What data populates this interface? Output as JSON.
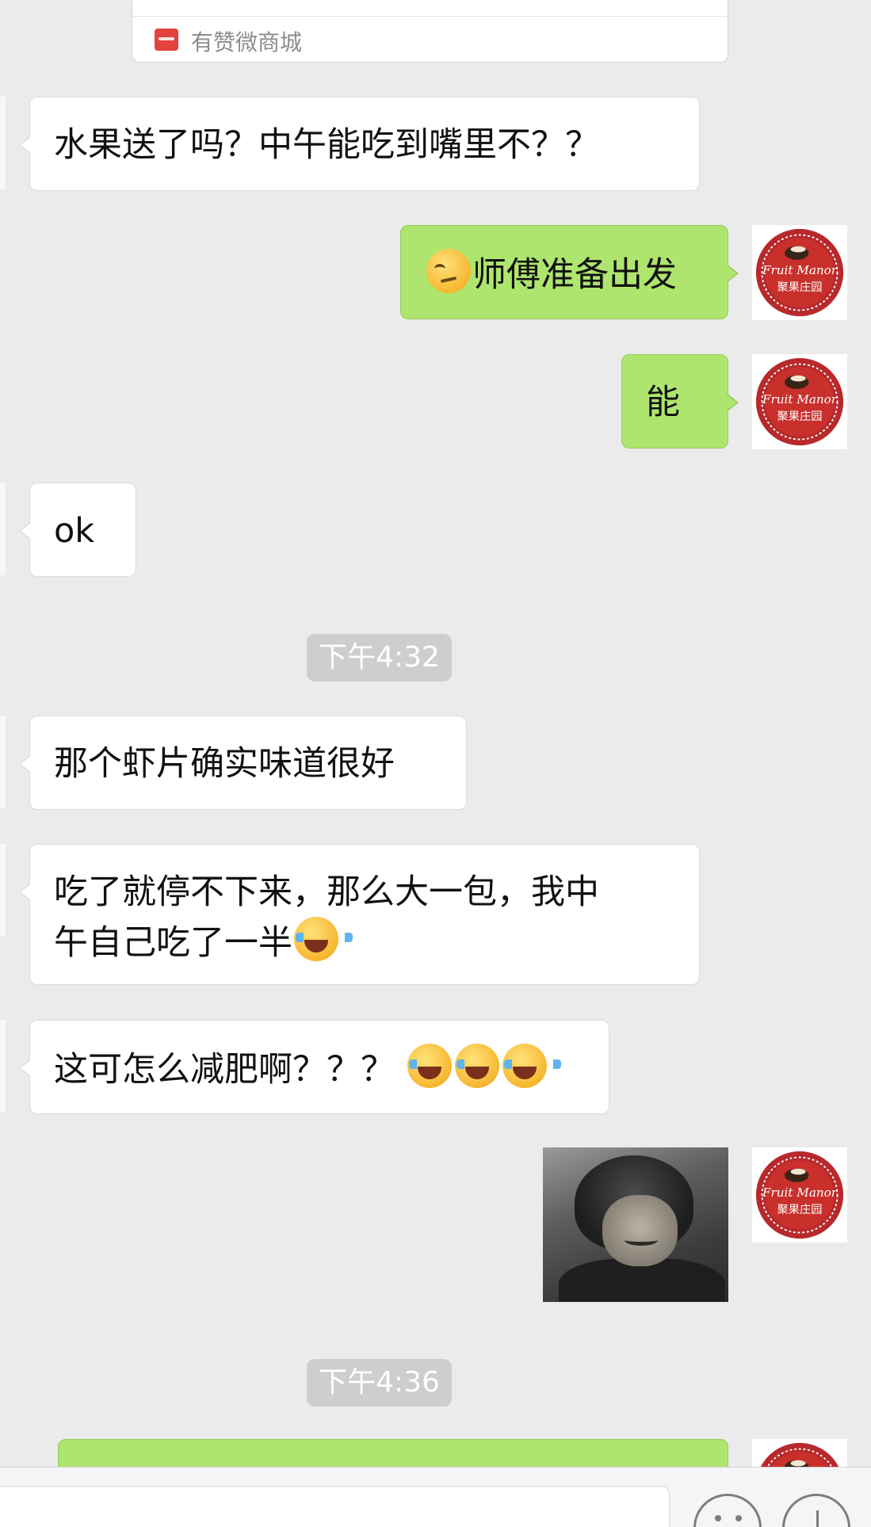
{
  "shared_card": {
    "shop_name": "有赞微商城",
    "shop_icon": "shop-app-icon"
  },
  "avatar": {
    "text_top": "Fruit Manor",
    "text_bottom": "聚果庄园",
    "colors": {
      "ring": "#b8292b",
      "inner": "#c9302c",
      "text": "#ffffff"
    }
  },
  "messages": [
    {
      "side": "left",
      "text": "水果送了吗？中午能吃到嘴里不？？"
    },
    {
      "side": "right",
      "emoji_prefix": "smirk-emoji",
      "text": "师傅准备出发"
    },
    {
      "side": "right",
      "text": "能"
    },
    {
      "side": "left",
      "text": "ok"
    },
    {
      "side": "left",
      "text": "那个虾片确实味道很好"
    },
    {
      "side": "left",
      "line1": "吃了就停不下来，那么大一包，我中",
      "line2": "午自己吃了一半",
      "emoji_suffix": [
        "laughing-crying-emoji"
      ]
    },
    {
      "side": "left",
      "text": "这可怎么减肥啊？？？ ",
      "emoji_suffix": [
        "laughing-crying-emoji",
        "laughing-crying-emoji",
        "laughing-crying-emoji"
      ]
    },
    {
      "side": "right",
      "type": "sticker",
      "sticker": "laughing-man-sticker"
    }
  ],
  "timestamps": [
    "下午4:32",
    "下午4:36"
  ],
  "colors": {
    "background": "#ebebeb",
    "right_bubble": "#aee56e",
    "left_bubble": "#ffffff",
    "timestamp_bg": "#cecece"
  },
  "input_bar": {
    "emoji_button_icon": "emoji-face-icon",
    "more_button_icon": "plus-icon"
  }
}
